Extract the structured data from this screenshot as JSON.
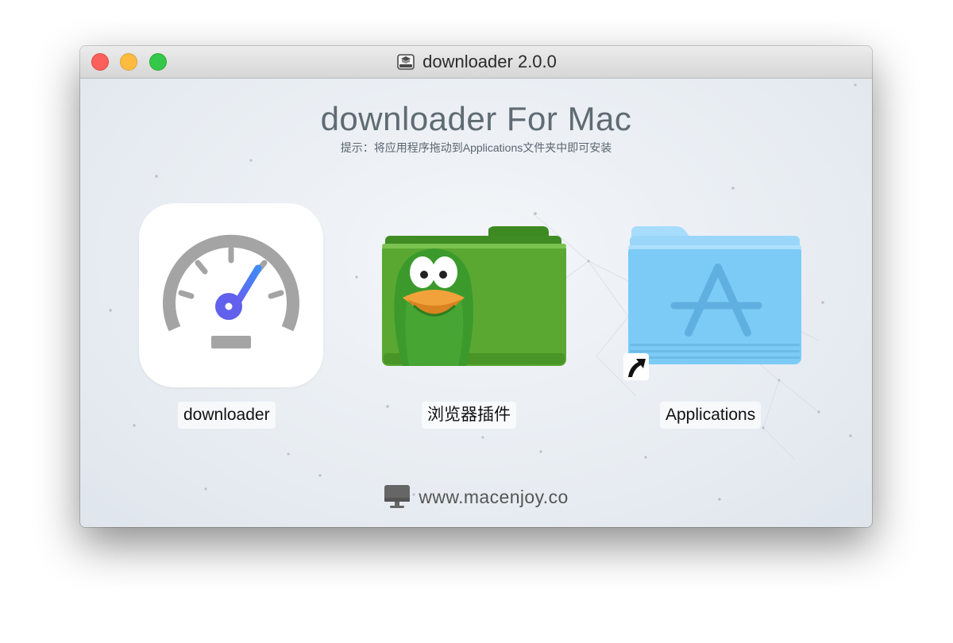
{
  "window": {
    "title": "downloader 2.0.0",
    "controls": [
      "close",
      "minimize",
      "zoom"
    ]
  },
  "installer": {
    "heading": "downloader For Mac",
    "hint": "提示：将应用程序拖动到Applications文件夹中即可安装"
  },
  "items": [
    {
      "label": "downloader",
      "icon": "speedometer-app-icon"
    },
    {
      "label": "浏览器插件",
      "icon": "green-duck-folder-icon"
    },
    {
      "label": "Applications",
      "icon": "applications-folder-icon"
    }
  ],
  "footer": {
    "url": "www.macenjoy.co",
    "icon": "monitor-icon"
  },
  "colors": {
    "traffic_close": "#fc605c",
    "traffic_minimize": "#fdbc40",
    "traffic_zoom": "#34c84a",
    "gauge_gray": "#a4a4a4",
    "needle_blue": "#4b73f0",
    "folder_green": "#5aa832",
    "folder_blue": "#7ccbf6"
  }
}
